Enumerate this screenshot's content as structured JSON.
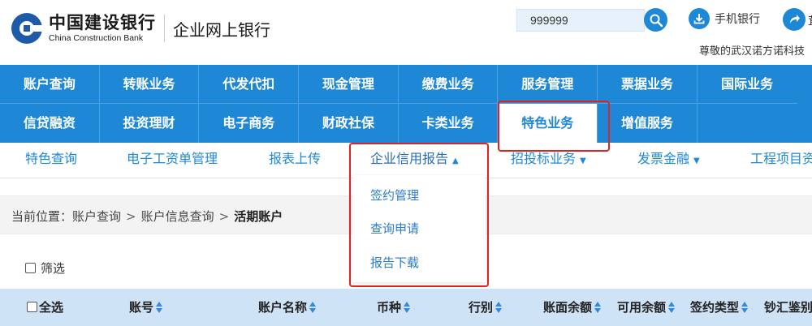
{
  "header": {
    "logo_cn": "中国建设银行",
    "logo_en": "China Construction Bank",
    "logo_sub": "企业网上银行",
    "search_value": "999999",
    "mobile_label": "手机银行",
    "share_tail": "茸",
    "greeting": "尊敬的武汉诺方诺科技"
  },
  "nav": {
    "row1": [
      "账户查询",
      "转账业务",
      "代发代扣",
      "现金管理",
      "缴费业务",
      "服务管理",
      "票据业务",
      "国际业务"
    ],
    "row2": [
      "信贷融资",
      "投资理财",
      "电子商务",
      "财政社保",
      "卡类业务",
      "特色业务",
      "增值服务"
    ],
    "active": "特色业务"
  },
  "subnav": {
    "items": [
      "特色查询",
      "电子工资单管理",
      "报表上传",
      "企业信用报告",
      "招投标业务",
      "发票金融",
      "工程项目资"
    ]
  },
  "dropdown": {
    "items": [
      "签约管理",
      "查询申请",
      "报告下载"
    ]
  },
  "breadcrumb": {
    "prefix": "当前位置：",
    "level1": "账户查询",
    "level2": "账户信息查询",
    "current": "活期账户",
    "separator": ">"
  },
  "filter": {
    "label": "筛选"
  },
  "table": {
    "select_all": "全选",
    "columns": [
      "账号",
      "账户名称",
      "币种",
      "行别",
      "账面余额",
      "可用余额",
      "签约类型",
      "钞汇鉴别"
    ]
  },
  "colors": {
    "nav_blue": "#1e88d6",
    "header_row": "#cfe3f6",
    "annotation_red": "#e02222"
  }
}
